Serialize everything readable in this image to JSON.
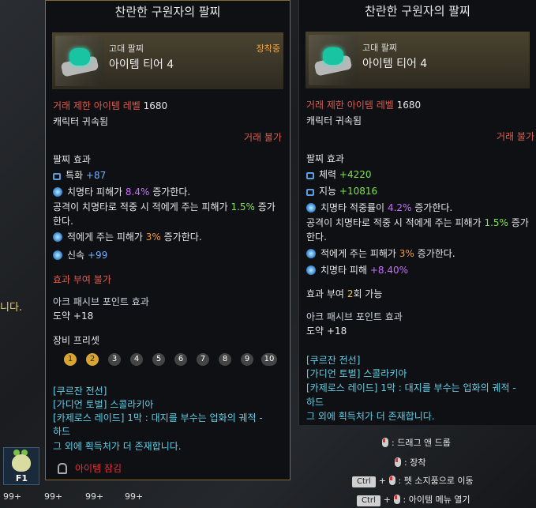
{
  "background": {
    "left_text": "니다.",
    "hud": {
      "hotkey": "F1",
      "counts": [
        "99+",
        "99+",
        "99+",
        "99+"
      ]
    }
  },
  "left_tooltip": {
    "title": "찬란한 구원자의 팔찌",
    "grade": "고대 팔찌",
    "tier": "아이템 티어 4",
    "equipped": "장착중",
    "trade_level_label": "거래 제한 아이템 레벨",
    "trade_level_value": "1680",
    "bound": "캐릭터 귀속됨",
    "untradable": "거래 불가",
    "effects_title": "팔찌 효과",
    "stat1_label": "특화",
    "stat1_value": "+87",
    "effect1_a": "치명타 피해가",
    "effect1_b": "8.4%",
    "effect1_c": "증가한다.",
    "effect2_a": "공격이 치명타로 적중 시 적에게 주는 피해가",
    "effect2_b": "1.5%",
    "effect2_c": "증가",
    "effect2_d": "한다.",
    "effect3_a": "적에게 주는 피해가",
    "effect3_b": "3%",
    "effect3_c": "증가한다.",
    "stat2_label": "신속",
    "stat2_value": "+99",
    "no_grant": "효과 부여 불가",
    "ark_title": "아크 패시브 포인트 효과",
    "ark_value": "도약 +18",
    "preset_title": "장비 프리셋",
    "presets": [
      "1",
      "2",
      "3",
      "4",
      "5",
      "6",
      "7",
      "8",
      "9",
      "10"
    ],
    "sources": [
      "[쿠르잔 전선]",
      "[가디언 토벌] 스콜라키아",
      "[카제로스 레이드] 1막 : 대지를 부수는 업화의 궤적 -",
      "하드",
      "그 외에 획득처가 더 존재합니다."
    ],
    "locked_label": "아이템 잠김"
  },
  "right_tooltip": {
    "title": "찬란한 구원자의 팔찌",
    "grade": "고대 팔찌",
    "tier": "아이템 티어 4",
    "trade_level_label": "거래 제한 아이템 레벨",
    "trade_level_value": "1680",
    "bound": "캐릭터 귀속됨",
    "untradable": "거래 불가",
    "effects_title": "팔찌 효과",
    "stat1_label": "체력",
    "stat1_value": "+4220",
    "stat2_label": "지능",
    "stat2_value": "+10816",
    "effect1_a": "치명타 적중률이",
    "effect1_b": "4.2%",
    "effect1_c": "증가한다.",
    "effect2_a": "공격이 치명타로 적중 시 적에게 주는 피해가",
    "effect2_b": "1.5%",
    "effect2_c": "증가",
    "effect2_d": "한다.",
    "effect3_a": "적에게 주는 피해가",
    "effect3_b": "3%",
    "effect3_c": "증가한다.",
    "effect4_a": "치명타 피해",
    "effect4_b": "+8.40%",
    "grant_a": "효과 부여",
    "grant_b": "2",
    "grant_c": "회 가능",
    "ark_title": "아크 패시브 포인트 효과",
    "ark_value": "도약 +18",
    "sources": [
      "[쿠르잔 전선]",
      "[가디언 토벌] 스콜라키아",
      "[카제로스 레이드] 1막 : 대지를 부수는 업화의 궤적 -",
      "하드",
      "그 외에 획득처가 더 존재합니다."
    ]
  },
  "hints": {
    "drag": ": 드래그 앤 드롭",
    "equip": ": 장착",
    "ctrl": "Ctrl",
    "plus": "+",
    "move_pet": ": 펫 소지품으로 이동",
    "open_menu": ": 아이템 메뉴 열기"
  }
}
